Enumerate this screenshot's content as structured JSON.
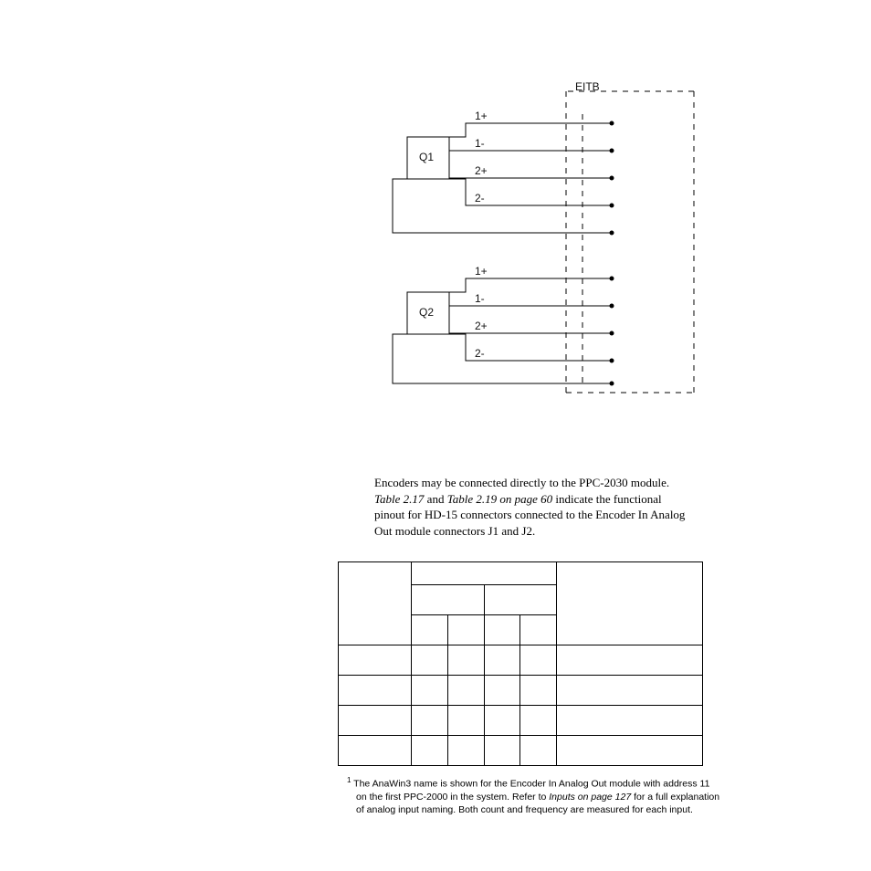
{
  "diagram": {
    "boundary_label": "EITB",
    "blocks": [
      {
        "name": "Q1",
        "signals": [
          "1+",
          "1-",
          "2+",
          "2-"
        ]
      },
      {
        "name": "Q2",
        "signals": [
          "1+",
          "1-",
          "2+",
          "2-"
        ]
      }
    ]
  },
  "paragraph": {
    "sent1": "Encoders may be connected directly to the PPC-2030 module.",
    "ref1": "Table 2.17",
    "mid1": " and ",
    "ref2": "Table 2.19 on page 60",
    "sent2": " indicate the functional pinout for HD-15 connectors connected to the Encoder In Analog Out module connectors J1 and J2."
  },
  "footnote": {
    "sup": "1",
    "t1": " The AnaWin3 name is shown for the Encoder In Analog Out module with address 11 on the first PPC-2000 in the system. Refer to ",
    "ref": "Inputs on page 127",
    "t2": " for a full explanation of analog input naming. Both count and frequency are measured for each input."
  }
}
